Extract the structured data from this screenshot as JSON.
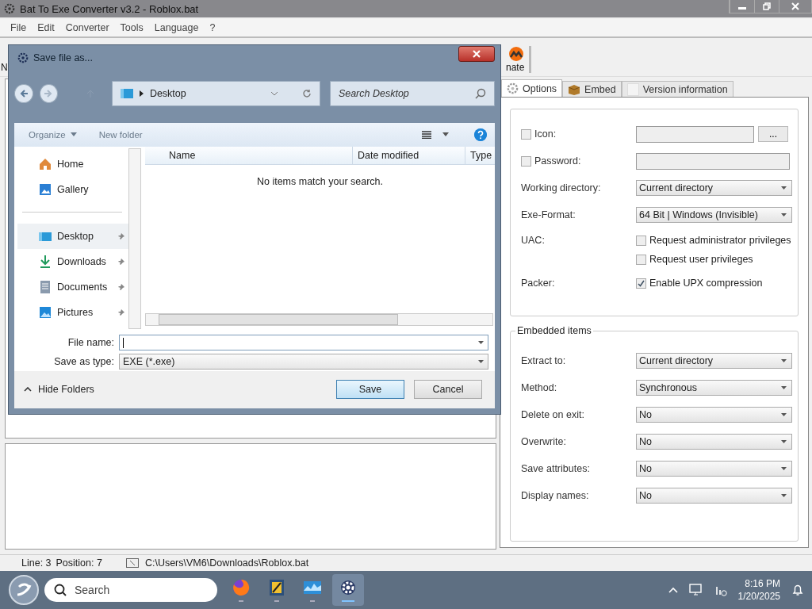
{
  "window": {
    "title": "Bat To Exe Converter v3.2 - Roblox.bat"
  },
  "menu": [
    "File",
    "Edit",
    "Converter",
    "Tools",
    "Language",
    "?"
  ],
  "toolbar": [
    {
      "kind": "cut-left",
      "label": "N"
    },
    {
      "kind": "coin",
      "label": "nate"
    }
  ],
  "tabs": [
    {
      "label": "Options",
      "selected": true
    },
    {
      "label": "Embed",
      "selected": false
    },
    {
      "label": "Version information",
      "selected": false
    }
  ],
  "options": [
    {
      "kind": "check-field",
      "label": "Icon:",
      "checked": false,
      "browse": "..."
    },
    {
      "kind": "check-field",
      "label": "Password:",
      "checked": false
    },
    {
      "kind": "select",
      "label": "Working directory:",
      "value": "Current directory"
    },
    {
      "kind": "select",
      "label": "Exe-Format:",
      "value": "64 Bit | Windows (Invisible)"
    },
    {
      "kind": "checks",
      "label": "UAC:",
      "options": [
        {
          "label": "Request administrator privileges",
          "checked": false
        },
        {
          "label": "Request user privileges",
          "checked": false
        }
      ]
    },
    {
      "kind": "checks",
      "label": "Packer:",
      "options": [
        {
          "label": "Enable UPX compression",
          "checked": true
        }
      ]
    }
  ],
  "embedded": {
    "title": "Embedded items",
    "rows": [
      {
        "label": "Extract to:",
        "value": "Current directory"
      },
      {
        "label": "Method:",
        "value": "Synchronous"
      },
      {
        "label": "Delete on exit:",
        "value": "No"
      },
      {
        "label": "Overwrite:",
        "value": "No"
      },
      {
        "label": "Save attributes:",
        "value": "No"
      },
      {
        "label": "Display names:",
        "value": "No"
      }
    ]
  },
  "status_bar": {
    "line": "Line: 3",
    "position": "Position: 7",
    "path": "C:\\Users\\VM6\\Downloads\\Roblox.bat"
  },
  "dialog": {
    "title": "Save file as...",
    "location": "Desktop",
    "search": {
      "placeholder": "Search Desktop"
    },
    "commands": [
      "Organize",
      "New folder"
    ],
    "nav_groups": [
      [
        {
          "label": "Home",
          "pinned": false,
          "selected": false
        },
        {
          "label": "Gallery",
          "pinned": false,
          "selected": false
        }
      ],
      [
        {
          "label": "Desktop",
          "pinned": true,
          "selected": true
        },
        {
          "label": "Downloads",
          "pinned": true,
          "selected": false
        },
        {
          "label": "Documents",
          "pinned": true,
          "selected": false
        },
        {
          "label": "Pictures",
          "pinned": true,
          "selected": false
        }
      ]
    ],
    "columns": [
      "Name",
      "Date modified",
      "Type"
    ],
    "empty_message": "No items match your search.",
    "file_name": {
      "label": "File name:"
    },
    "save_as_type": {
      "label": "Save as type:",
      "value": "EXE (*.exe)"
    },
    "hide_folders": "Hide Folders",
    "buttons": [
      {
        "label": "Save",
        "default": true
      },
      {
        "label": "Cancel",
        "default": false
      }
    ]
  },
  "taskbar": {
    "search": {
      "placeholder": "Search"
    },
    "apps": [
      {
        "kind": "firefox",
        "active": false
      },
      {
        "kind": "editor",
        "active": false
      },
      {
        "kind": "monitor",
        "active": false
      },
      {
        "kind": "gear",
        "active": true
      }
    ],
    "time": "8:16 PM",
    "date": "1/20/2025"
  }
}
